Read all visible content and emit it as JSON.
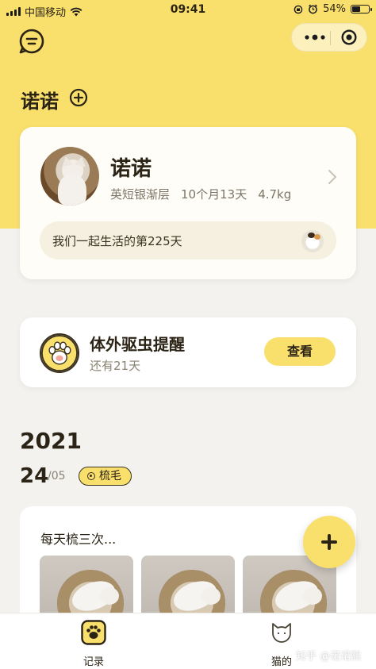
{
  "status_bar": {
    "carrier": "中国移动",
    "time": "09:41",
    "battery": "54%",
    "battery_level": 0.54
  },
  "header": {
    "pet_name": "诺诺",
    "menu_icon": "chat-menu-icon",
    "more_icon": "more-dots-icon",
    "close_icon": "target-circle-icon",
    "add_icon": "add-circle-icon"
  },
  "profile": {
    "name": "诺诺",
    "breed": "英短银渐层",
    "age": "10个月13天",
    "weight": "4.7kg",
    "days_together": "我们一起生活的第225天"
  },
  "reminder": {
    "title": "体外驱虫提醒",
    "subtitle": "还有21天",
    "button": "查看"
  },
  "timeline": {
    "year": "2021",
    "day": "24",
    "month": "/05",
    "tag": "梳毛",
    "record_text": "每天梳三次..."
  },
  "tabs": [
    {
      "label": "记录",
      "icon": "paw-icon"
    },
    {
      "label": "猫的",
      "icon": "cat-face-icon"
    }
  ],
  "watermark": "知乎 @诺诺熙",
  "colors": {
    "accent": "#f9df6b",
    "text": "#2b2416",
    "background": "#f3f2ef"
  }
}
